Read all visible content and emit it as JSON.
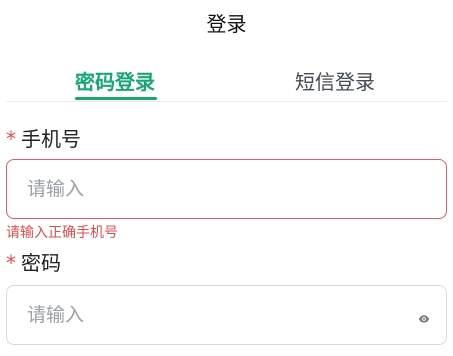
{
  "header": {
    "title": "登录"
  },
  "tabs": [
    {
      "label": "密码登录",
      "active": true
    },
    {
      "label": "短信登录",
      "active": false
    }
  ],
  "form": {
    "phone": {
      "required_mark": "*",
      "label": "手机号",
      "placeholder": "请输入",
      "value": "",
      "error": "请输入正确手机号"
    },
    "password": {
      "required_mark": "*",
      "label": "密码",
      "placeholder": "请输入",
      "value": "",
      "toggle_icon": "eye-icon"
    }
  },
  "colors": {
    "accent": "#17a870",
    "error": "#e34d4d",
    "error_border": "#e45a63",
    "border": "#d9d9d9",
    "placeholder": "#9aa0a6"
  }
}
